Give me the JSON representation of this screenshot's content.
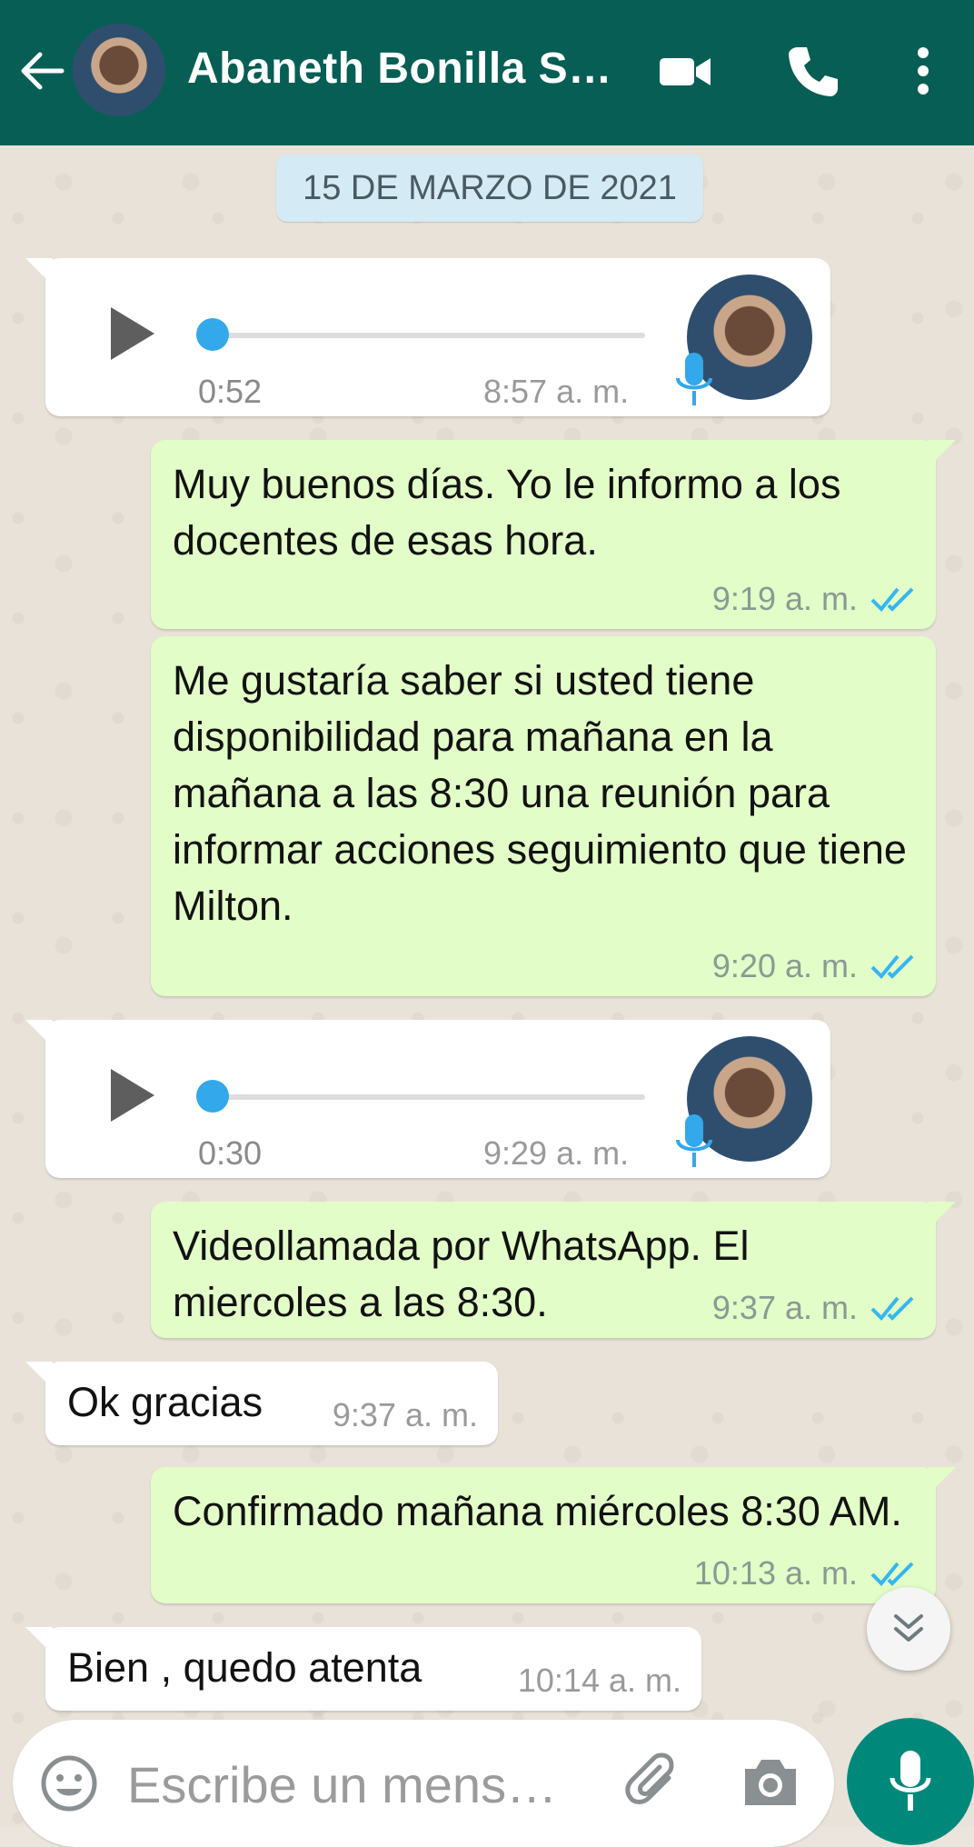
{
  "header": {
    "title": "Abaneth Bonilla So…",
    "colors": {
      "bar": "#075e54",
      "icons": "#ffffff"
    },
    "icons": [
      "back-arrow-icon",
      "video-call-icon",
      "phone-icon",
      "more-vert-icon"
    ]
  },
  "date_chip": "15 DE MARZO DE 2021",
  "messages": [
    {
      "type": "voice",
      "direction": "in",
      "duration": "0:52",
      "time": "8:57 a. m.",
      "progress": 0
    },
    {
      "type": "text",
      "direction": "out",
      "text": "Muy buenos días. Yo le informo a los docentes de esas hora.",
      "time": "9:19 a. m.",
      "status": "read"
    },
    {
      "type": "text",
      "direction": "out",
      "text": "Me gustaría saber si usted tiene disponibilidad para mañana en la mañana a las 8:30 una reunión para informar acciones seguimiento que tiene Milton.",
      "time": "9:20 a. m.",
      "status": "read"
    },
    {
      "type": "voice",
      "direction": "in",
      "duration": "0:30",
      "time": "9:29 a. m.",
      "progress": 0
    },
    {
      "type": "text",
      "direction": "out",
      "text": "Videollamada por WhatsApp. El miercoles a las 8:30.",
      "time": "9:37 a. m.",
      "status": "read"
    },
    {
      "type": "text",
      "direction": "in",
      "text": "Ok gracias",
      "time": "9:37 a. m."
    },
    {
      "type": "text",
      "direction": "out",
      "text": "Confirmado mañana miércoles 8:30 AM.",
      "time": "10:13 a. m.",
      "status": "read"
    },
    {
      "type": "text",
      "direction": "in",
      "text": "Bien , quedo atenta",
      "time": "10:14 a. m."
    }
  ],
  "composer": {
    "placeholder": "Escribe un mens…",
    "icons": [
      "emoji-icon",
      "attach-icon",
      "camera-icon",
      "mic-icon"
    ],
    "send_button_color": "#00897b"
  },
  "colors": {
    "outgoing_bubble": "#e2fdc7",
    "incoming_bubble": "#ffffff",
    "read_ticks": "#34b7f1",
    "voice_knob": "#33a8ea"
  }
}
